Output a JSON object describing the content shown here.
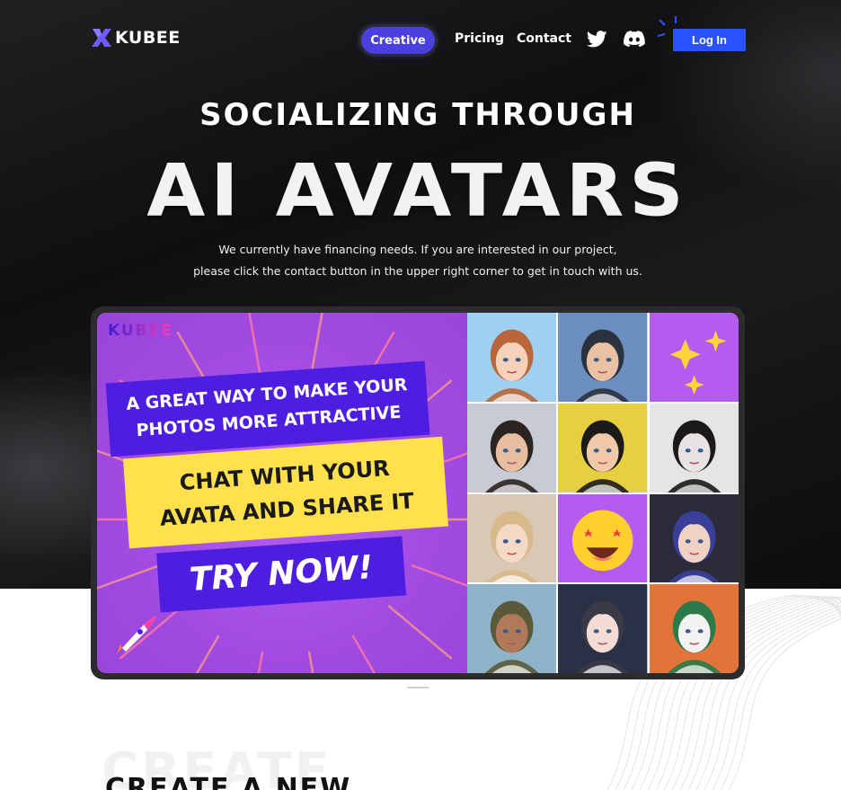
{
  "brand": {
    "name": "KUBEE",
    "accent": "#2a52ff",
    "purple": "#4b3fe0"
  },
  "nav": {
    "creative": "Creative",
    "pricing": "Pricing",
    "contact": "Contact",
    "twitter_icon": "twitter-icon",
    "discord_icon": "discord-icon",
    "login": "Log In"
  },
  "hero": {
    "subtitle": "SOCIALIZING THROUGH",
    "title": "AI AVATARS",
    "desc_line1": "We currently have financing needs. If you are interested in our project,",
    "desc_line2": "please click the contact button in the upper right corner to get in touch with us."
  },
  "banner": {
    "logo": "KUBEE",
    "line1a": "A GREAT WAY TO MAKE YOUR",
    "line1b": "PHOTOS MORE ATTRACTIVE",
    "line2a": "CHAT WITH YOUR",
    "line2b": "AVATA AND SHARE IT",
    "cta": "TRY NOW!",
    "tiles": [
      {
        "kind": "avatar",
        "bg": "#9fd0f0",
        "skin": "#f7d2bb",
        "hair": "#b8663a"
      },
      {
        "kind": "avatar",
        "bg": "#6a8fc0",
        "skin": "#e9c2a4",
        "hair": "#2c3140"
      },
      {
        "kind": "sparkles",
        "bg": "#b45cf0"
      },
      {
        "kind": "avatar",
        "bg": "#c9cbd4",
        "skin": "#e7bfa0",
        "hair": "#2b2420"
      },
      {
        "kind": "avatar",
        "bg": "#e6d040",
        "skin": "#f0c9a8",
        "hair": "#1d1a1a"
      },
      {
        "kind": "avatar",
        "bg": "#e5e5e5",
        "skin": "#e8e2e6",
        "hair": "#1a1a1a"
      },
      {
        "kind": "avatar",
        "bg": "#d9c8b4",
        "skin": "#f3d9c6",
        "hair": "#d8b98a"
      },
      {
        "kind": "emoji",
        "bg": "#b45cf0"
      },
      {
        "kind": "avatar",
        "bg": "#2d2a3a",
        "skin": "#f0d2c4",
        "hair": "#3a3f9a"
      },
      {
        "kind": "avatar",
        "bg": "#8fb3c8",
        "skin": "#b07a5a",
        "hair": "#5a5a3a"
      },
      {
        "kind": "avatar",
        "bg": "#2a3046",
        "skin": "#f4dcd4",
        "hair": "#3a3a46"
      },
      {
        "kind": "avatar",
        "bg": "#e2743a",
        "skin": "#f2f2f2",
        "hair": "#2c7a4a"
      }
    ]
  },
  "section": {
    "ghost": "CREATE",
    "title": "CREATE A NEW"
  }
}
